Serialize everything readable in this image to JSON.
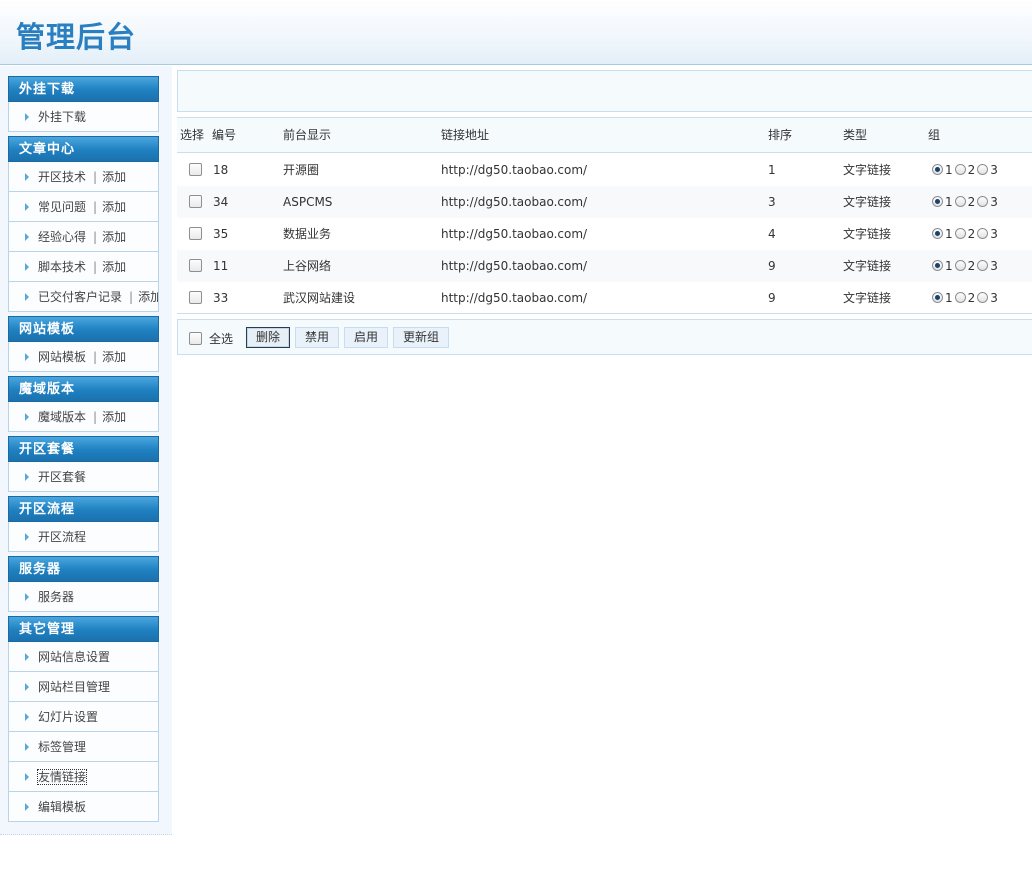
{
  "header": {
    "title": "管理后台"
  },
  "sidebar": {
    "groups": [
      {
        "title": "外挂下载",
        "items": [
          {
            "label": "外挂下载"
          }
        ]
      },
      {
        "title": "文章中心",
        "items": [
          {
            "label": "开区技术",
            "add": "添加"
          },
          {
            "label": "常见问题",
            "add": "添加"
          },
          {
            "label": "经验心得",
            "add": "添加"
          },
          {
            "label": "脚本技术",
            "add": "添加"
          },
          {
            "label": "已交付客户记录",
            "add": "添加"
          }
        ]
      },
      {
        "title": "网站模板",
        "items": [
          {
            "label": "网站模板",
            "add": "添加"
          }
        ]
      },
      {
        "title": "魔域版本",
        "items": [
          {
            "label": "魔域版本",
            "add": "添加"
          }
        ]
      },
      {
        "title": "开区套餐",
        "items": [
          {
            "label": "开区套餐"
          }
        ]
      },
      {
        "title": "开区流程",
        "items": [
          {
            "label": "开区流程"
          }
        ]
      },
      {
        "title": "服务器",
        "items": [
          {
            "label": "服务器"
          }
        ]
      },
      {
        "title": "其它管理",
        "items": [
          {
            "label": "网站信息设置"
          },
          {
            "label": "网站栏目管理"
          },
          {
            "label": "幻灯片设置"
          },
          {
            "label": "标签管理"
          },
          {
            "label": "友情链接"
          },
          {
            "label": "编辑模板"
          }
        ]
      }
    ]
  },
  "table": {
    "headers": {
      "select": "选择",
      "id": "编号",
      "name": "前台显示",
      "url": "链接地址",
      "order": "排序",
      "type": "类型",
      "group": "组"
    },
    "rows": [
      {
        "id": "18",
        "name": "开源圈",
        "url": "http://dg50.taobao.com/",
        "order": "1",
        "type": "文字链接",
        "group": "1"
      },
      {
        "id": "34",
        "name": "ASPCMS",
        "url": "http://dg50.taobao.com/",
        "order": "3",
        "type": "文字链接",
        "group": "1"
      },
      {
        "id": "35",
        "name": "数据业务",
        "url": "http://dg50.taobao.com/",
        "order": "4",
        "type": "文字链接",
        "group": "1"
      },
      {
        "id": "11",
        "name": "上谷网络",
        "url": "http://dg50.taobao.com/",
        "order": "9",
        "type": "文字链接",
        "group": "1"
      },
      {
        "id": "33",
        "name": "武汉网站建设",
        "url": "http://dg50.taobao.com/",
        "order": "9",
        "type": "文字链接",
        "group": "1"
      }
    ],
    "group_options": [
      "1",
      "2",
      "3"
    ]
  },
  "actions": {
    "select_all": "全选",
    "delete": "删除",
    "disable": "禁用",
    "enable": "启用",
    "update_group": "更新组"
  }
}
